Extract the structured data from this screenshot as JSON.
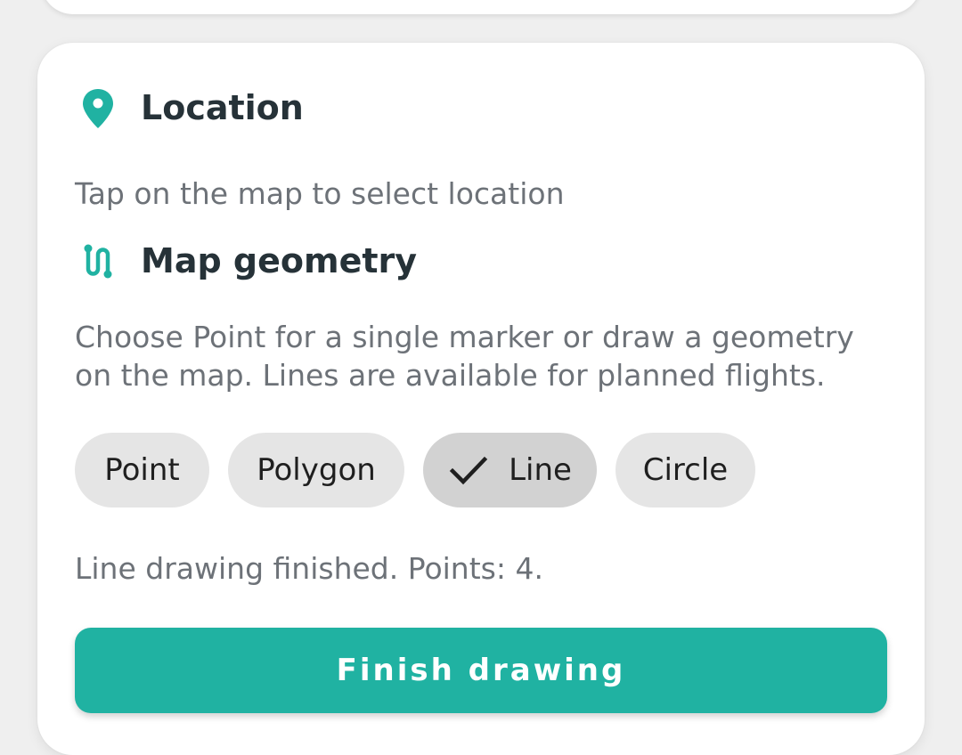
{
  "location": {
    "title": "Location",
    "icon": "map-pin-icon",
    "help": "Tap on the map to select location"
  },
  "geometry": {
    "title": "Map geometry",
    "icon": "route-icon",
    "help": "Choose Point for a single marker or draw a geometry on the map. Lines are available for planned flights.",
    "options": [
      {
        "label": "Point",
        "selected": false
      },
      {
        "label": "Polygon",
        "selected": false
      },
      {
        "label": "Line",
        "selected": true
      },
      {
        "label": "Circle",
        "selected": false
      }
    ],
    "status": "Line drawing finished. Points: 4."
  },
  "actions": {
    "finish_label": "Finish drawing"
  },
  "colors": {
    "accent": "#20b2a2",
    "title_text": "#263238",
    "help_text": "#6d7278",
    "chip_bg": "#e5e5e5",
    "chip_selected_bg": "#d2d2d2"
  }
}
